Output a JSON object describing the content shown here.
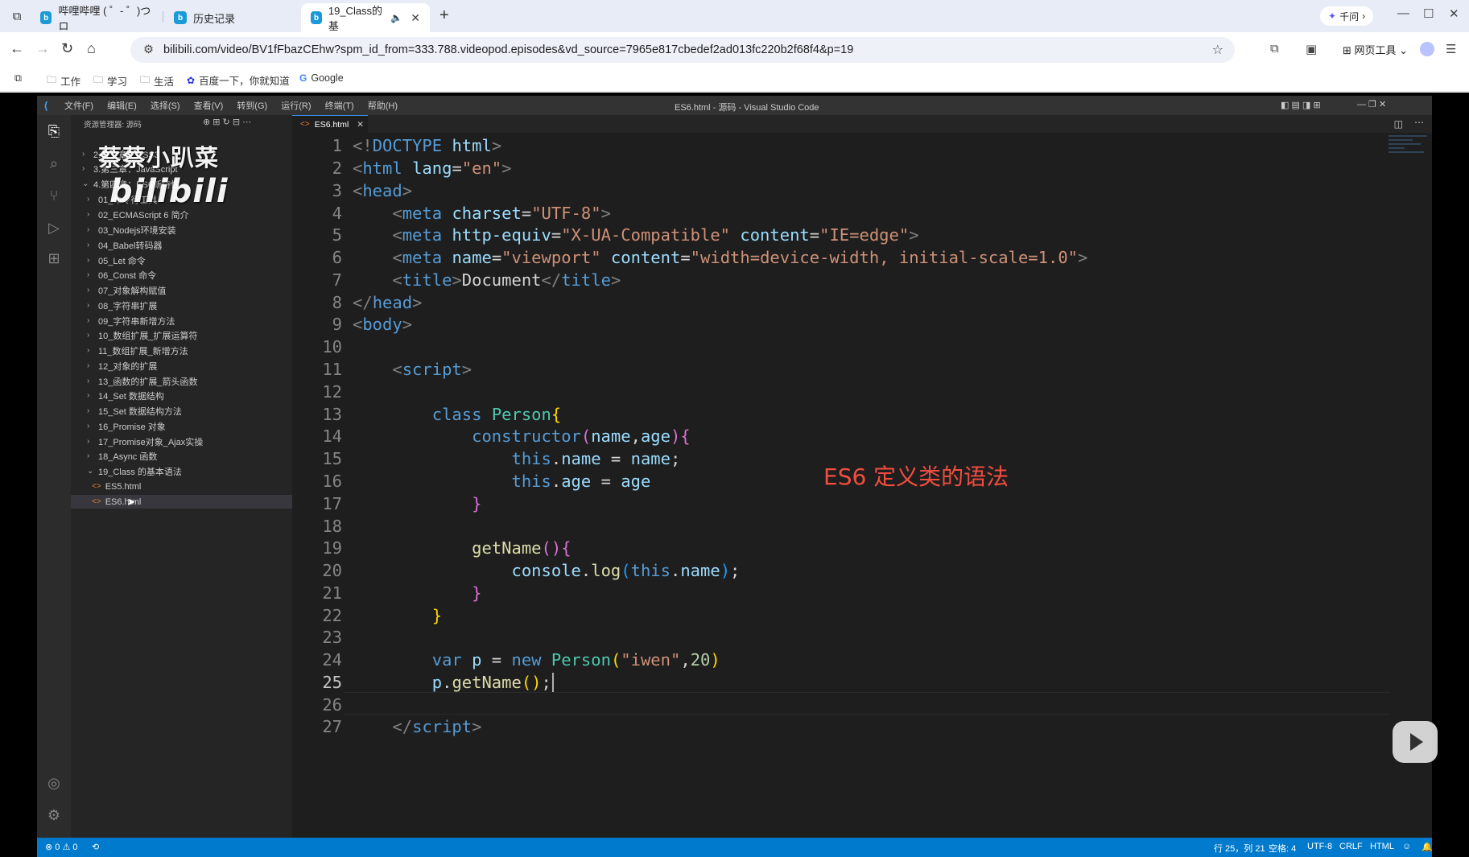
{
  "browser": {
    "tabs": [
      {
        "label": "哔哩哔哩 ( ゜- ゜)つロ"
      },
      {
        "label": "历史记录"
      },
      {
        "label": "19_Class的基"
      }
    ],
    "qianwen": "千问",
    "url": "bilibili.com/video/BV1fFbazCEhw?spm_id_from=333.788.videopod.episodes&vd_source=7965e817cbedef2ad013fc220b2f68f4&p=19",
    "tools_label": "网页工具",
    "bookmarks": [
      "工作",
      "学习",
      "生活",
      "百度一下，你就知道",
      "Google"
    ]
  },
  "vscode": {
    "menu": [
      "文件(F)",
      "编辑(E)",
      "选择(S)",
      "查看(V)",
      "转到(G)",
      "运行(R)",
      "终端(T)",
      "帮助(H)"
    ],
    "window_title": "ES6.html - 源码 - Visual Studio Code",
    "explorer_title": "资源管理器: 源码",
    "watermark": "蔡蔡小趴菜",
    "watermark_brand": "bilibili",
    "tree": [
      {
        "label": "2.第二章：CSS3"
      },
      {
        "label": "3.第三章：JavaScript"
      },
      {
        "label": "4.第四章：ES6新特性"
      },
      {
        "label": "01_命令行工具"
      },
      {
        "label": "02_ECMAScript 6 简介"
      },
      {
        "label": "03_Nodejs环境安装"
      },
      {
        "label": "04_Babel转码器"
      },
      {
        "label": "05_Let 命令"
      },
      {
        "label": "06_Const 命令"
      },
      {
        "label": "07_对象解构赋值"
      },
      {
        "label": "08_字符串扩展"
      },
      {
        "label": "09_字符串新增方法"
      },
      {
        "label": "10_数组扩展_扩展运算符"
      },
      {
        "label": "11_数组扩展_新增方法"
      },
      {
        "label": "12_对象的扩展"
      },
      {
        "label": "13_函数的扩展_箭头函数"
      },
      {
        "label": "14_Set 数据结构"
      },
      {
        "label": "15_Set 数据结构方法"
      },
      {
        "label": "16_Promise 对象"
      },
      {
        "label": "17_Promise对象_Ajax实操"
      },
      {
        "label": "18_Async 函数"
      },
      {
        "label": "19_Class 的基本语法"
      },
      {
        "label": "ES5.html"
      },
      {
        "label": "ES6.html"
      }
    ],
    "editor_tab": "ES6.html",
    "line_numbers": [
      "1",
      "2",
      "3",
      "4",
      "5",
      "6",
      "7",
      "8",
      "9",
      "10",
      "11",
      "12",
      "13",
      "14",
      "15",
      "16",
      "17",
      "18",
      "19",
      "20",
      "21",
      "22",
      "23",
      "24",
      "25",
      "26",
      "27"
    ],
    "annotation": "ES6 定义类的语法",
    "status": {
      "errors": "⊗ 0 ⚠ 0",
      "position": "行 25，列 21",
      "spaces": "空格: 4",
      "encoding": "UTF-8",
      "eol": "CRLF",
      "language": "HTML"
    }
  }
}
